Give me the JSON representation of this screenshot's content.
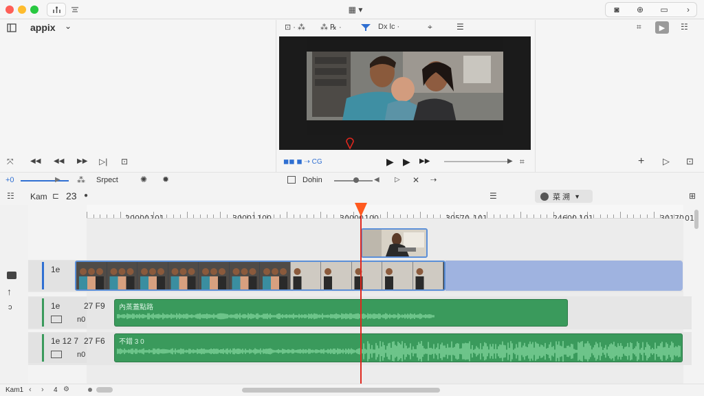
{
  "titlebar": {
    "view_menu": "▦ ▾",
    "right_buttons": [
      "◙",
      "⊕",
      "▭",
      "›"
    ]
  },
  "browser": {
    "library_name": "appix",
    "controls": [
      "⤧",
      "◀◀",
      "◀◀",
      "▶▶",
      "▷|",
      "⊡"
    ]
  },
  "viewer": {
    "top_controls": [
      "⊡ · ⁂",
      "⁂ ℞ ·",
      "Dx lc ·",
      "⌖",
      "☰"
    ],
    "transport_left": "◼◼ ◼ ⇢ CG",
    "play_label": "▶",
    "right_icon": "⌗"
  },
  "inspector": {
    "icons": [
      "⌗",
      "▶",
      "☷"
    ],
    "bottom_icons": [
      "+",
      "▷",
      "⊡"
    ]
  },
  "toolbar": {
    "zoom_label": "+0",
    "tool_name": "Srpect",
    "mid_label": "Dohin",
    "icons_right": [
      "▷",
      "✕",
      "⇢"
    ]
  },
  "track_header": {
    "project_label": "Kam",
    "count": "23",
    "list_icon": "☰",
    "selector_label": "菜 溯",
    "right_icon": "⊞"
  },
  "ruler": {
    "labels": [
      "20000",
      "101",
      "30001",
      "100",
      "30000",
      "100",
      "30570",
      "101",
      "24600",
      "101",
      "30170",
      "01"
    ]
  },
  "lanes": {
    "video": {
      "label": "1e"
    },
    "audio1": {
      "label": "1e",
      "code": "27 F9",
      "sub": "n0",
      "clip_name": "內蒸蓋點路"
    },
    "audio2": {
      "label": "1e 12 7",
      "code": "27 F6",
      "sub": "n0",
      "clip_name": "不錯 3 0"
    }
  },
  "bottom_bar": {
    "left_text": "Kam1",
    "page": "4"
  },
  "colors": {
    "video_clip": "#2f3b4a",
    "video_lane_fill": "#9fb3e0",
    "audio_clip": "#3a9a5c",
    "playhead": "#e0271e",
    "accent_blue": "#2f6fd2"
  }
}
